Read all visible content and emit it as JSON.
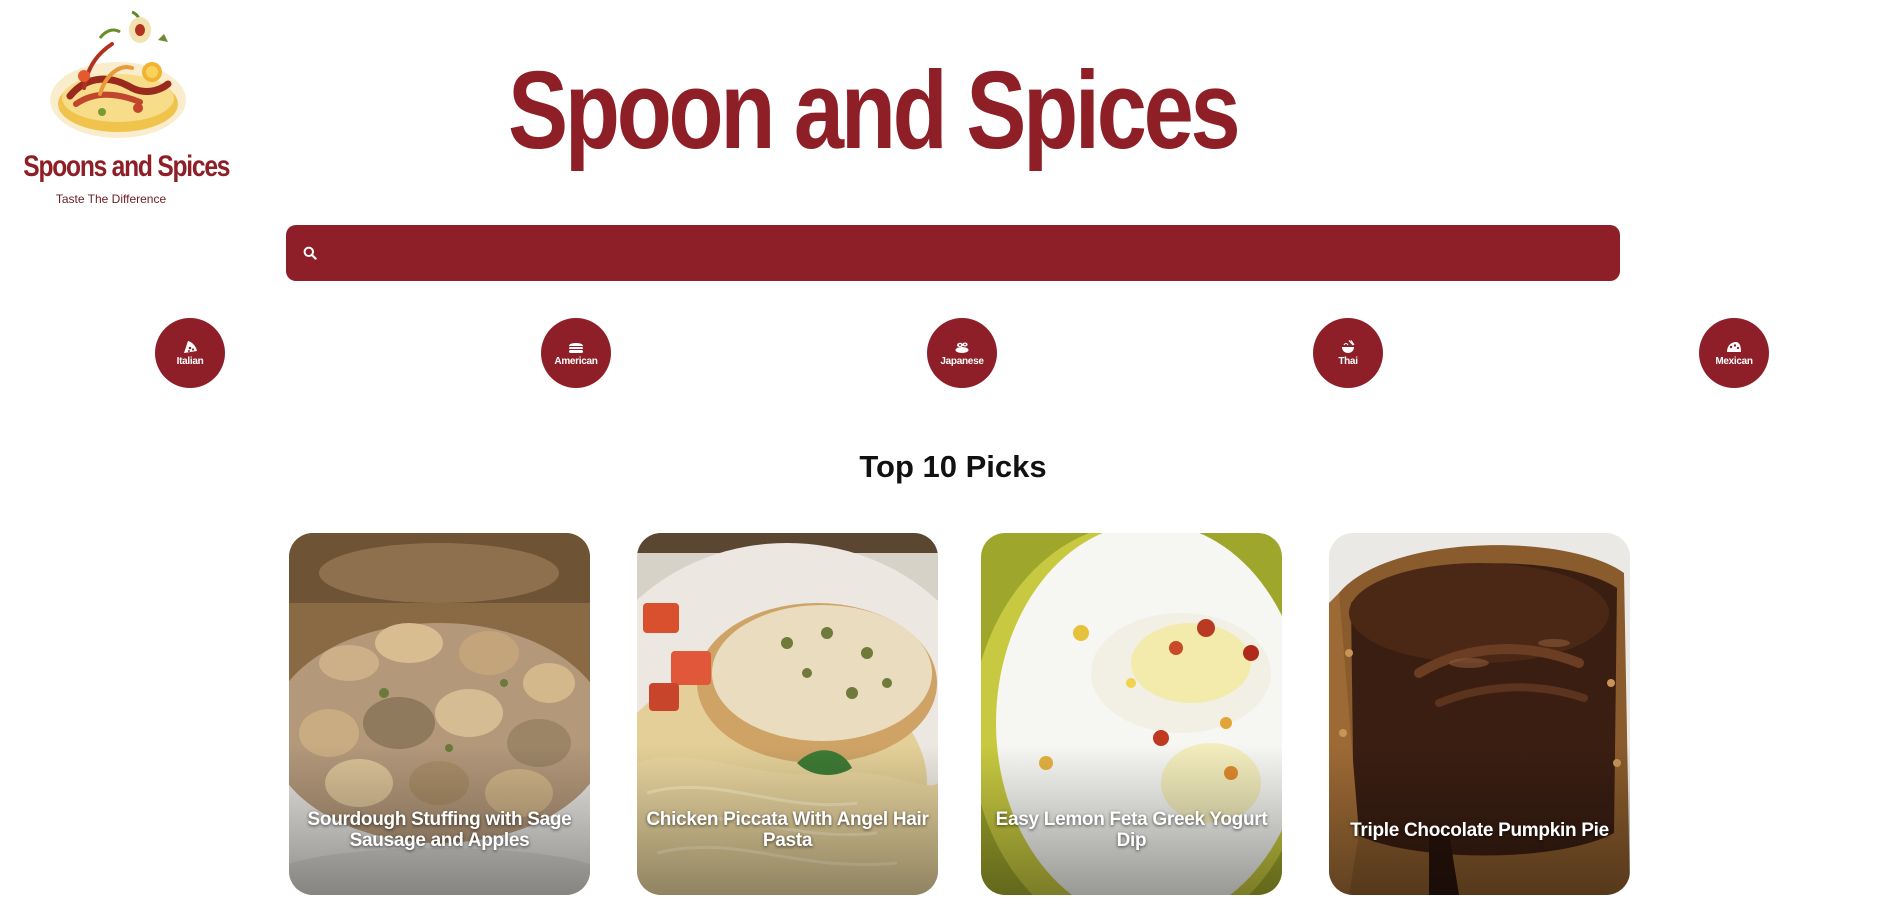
{
  "logo": {
    "name": "Spoons and Spices",
    "tagline": "Taste The Difference"
  },
  "header": {
    "title": "Spoon and Spices"
  },
  "search": {
    "value": "",
    "placeholder": "",
    "icon": "search-icon"
  },
  "cuisines": [
    {
      "label": "Italian",
      "icon": "pizza-slice-icon"
    },
    {
      "label": "American",
      "icon": "burger-icon"
    },
    {
      "label": "Japanese",
      "icon": "sushi-icon"
    },
    {
      "label": "Thai",
      "icon": "noodle-bowl-icon"
    },
    {
      "label": "Mexican",
      "icon": "taco-icon"
    }
  ],
  "top_picks": {
    "heading": "Top 10 Picks",
    "cards": [
      {
        "title": "Sourdough Stuffing with Sage Sausage and Apples"
      },
      {
        "title": "Chicken Piccata With Angel Hair Pasta"
      },
      {
        "title": "Easy Lemon Feta Greek Yogurt Dip"
      },
      {
        "title": "Triple Chocolate Pumpkin Pie"
      }
    ]
  },
  "colors": {
    "brand": "#8e1f28",
    "text_dark": "#111111",
    "background": "#ffffff"
  }
}
